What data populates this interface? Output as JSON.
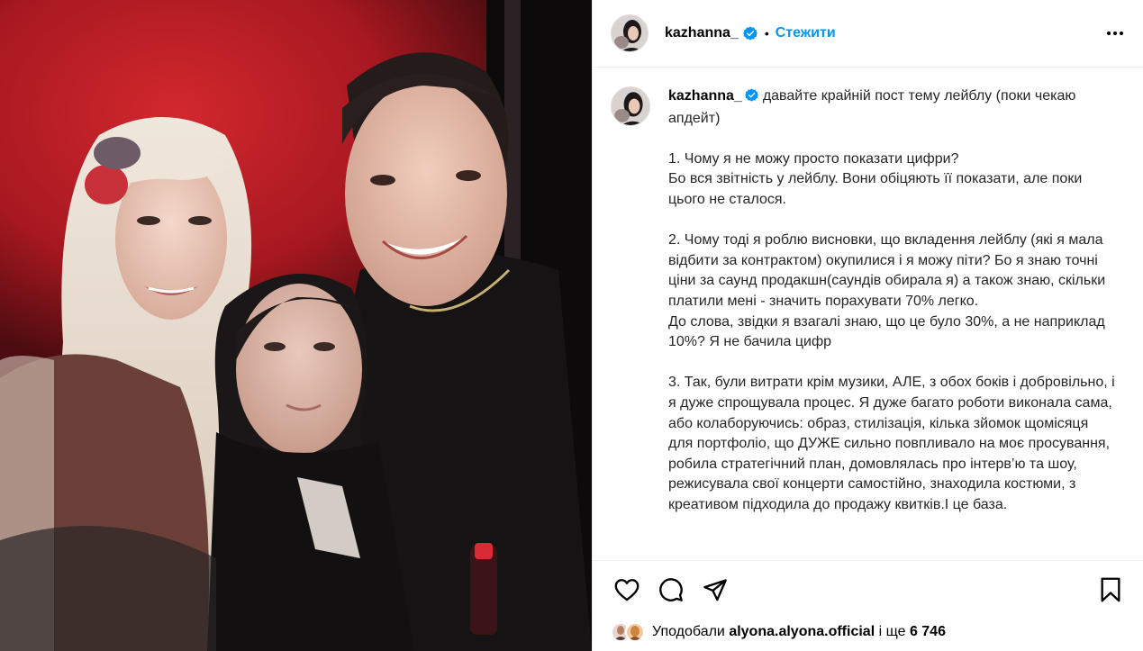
{
  "post": {
    "username": "kazhanna_",
    "dot": "•",
    "follow_label": "Стежити",
    "caption": "давайте крайній пост тему лейблу (поки чекаю апдейт)\n\n1. Чому я не можу просто показати цифри?\nБо вся звітність у лейблу. Вони обіцяють її показати, але поки цього не сталося.\n\n2. Чому тоді я роблю висновки, що вкладення лейблу (які я мала відбити за контрактом) окупилися і я можу піти? Бо я знаю точні ціни за саунд продакшн(саундів обирала я) а також знаю, скільки платили мені - значить порахувати 70% легко.\nДо слова, звідки я взагалі знаю, що це було 30%, а не наприклад 10%? Я не бачила цифр\n\n3. Так, були витрати крім музики, АЛЕ, з обох боків і добровільно, і я дуже спрощувала процес. Я дуже багато роботи виконала сама, або колаборуючись: образ, стилізація, кілька зйомок щомісяця для портфоліо, що ДУЖЕ сильно повпливало на моє просування, робила стратегічний план, домовлялась про інтерв’ю та шоу, режисувала свої концерти самостійно, знаходила костюми, з креативом підходила до продажу квитків.І це база."
  },
  "likes": {
    "prefix": "Уподобали",
    "user": "alyona.alyona.official",
    "middle": "і ще",
    "count": "6 746"
  },
  "icons": {
    "verified": "verified-badge-icon",
    "more": "more-options-icon",
    "like": "heart-icon",
    "comment": "comment-icon",
    "share": "paper-plane-icon",
    "save": "bookmark-icon"
  },
  "colors": {
    "accent": "#0095f6",
    "verified": "#0095f6",
    "border": "#efefef"
  }
}
